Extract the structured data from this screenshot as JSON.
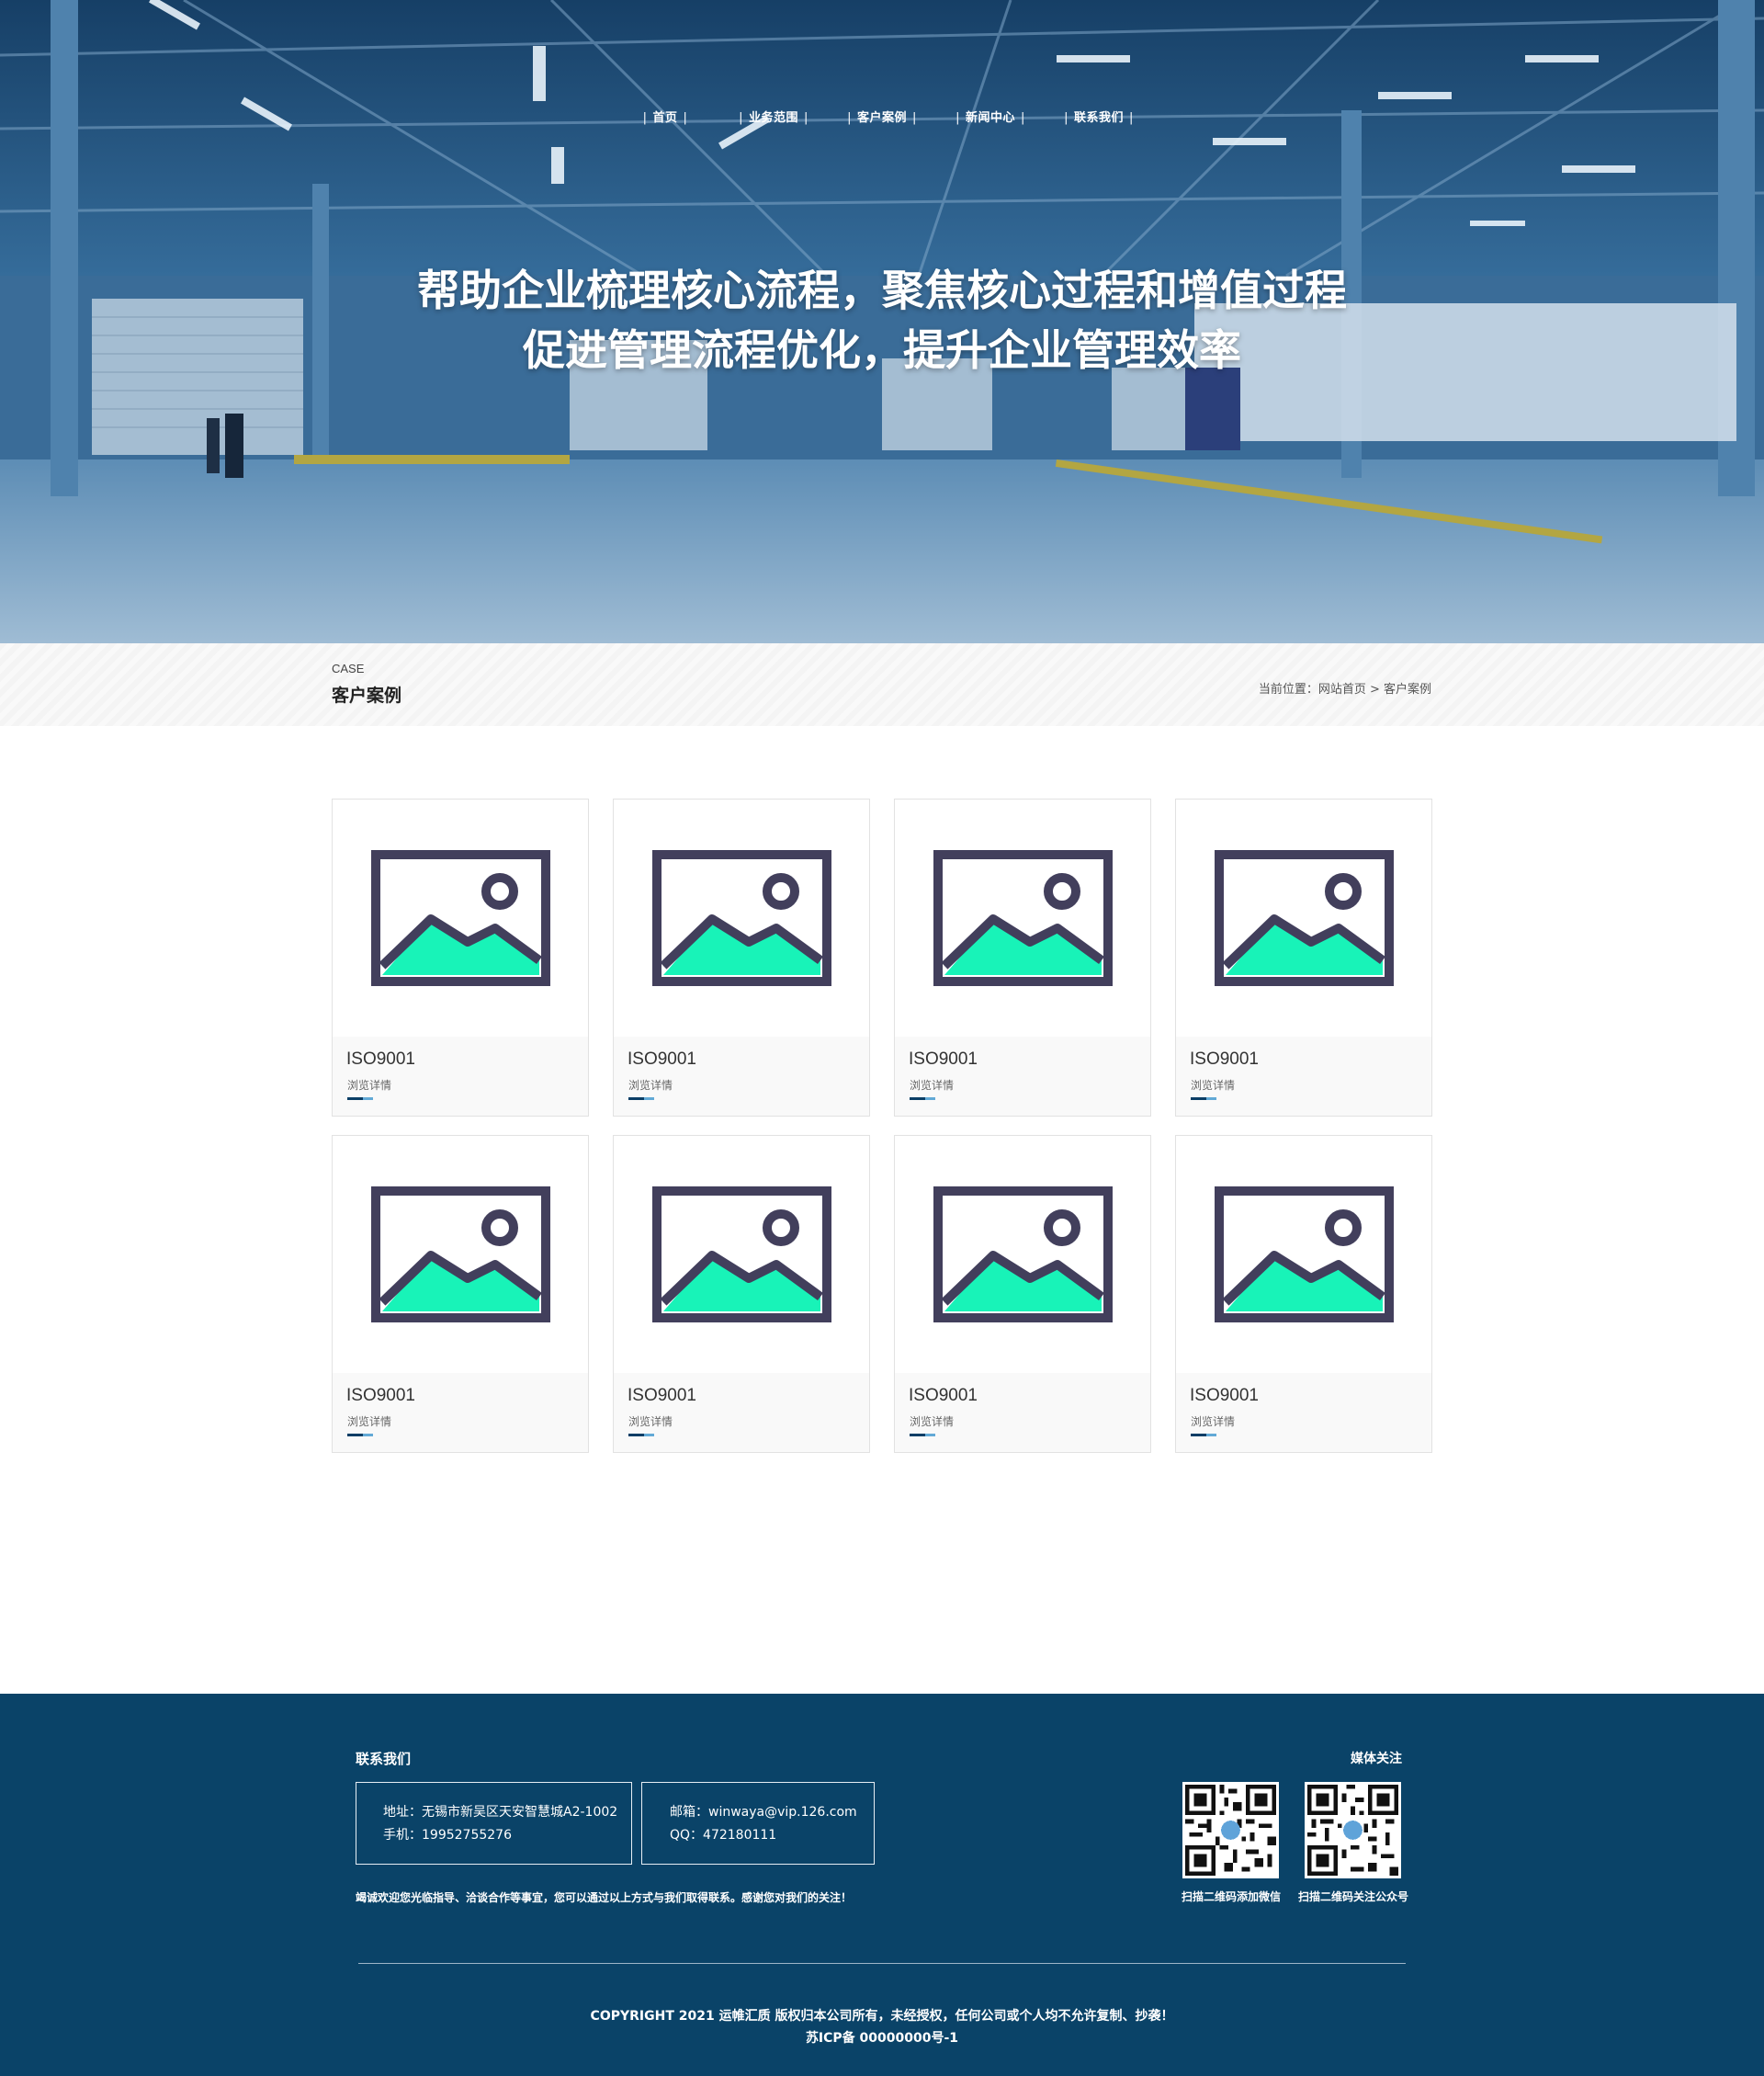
{
  "nav": {
    "items": [
      {
        "label": "首页"
      },
      {
        "label": "业务范围"
      },
      {
        "label": "客户案例"
      },
      {
        "label": "新闻中心"
      },
      {
        "label": "联系我们"
      }
    ]
  },
  "hero": {
    "line1": "帮助企业梳理核心流程，聚焦核心过程和增值过程",
    "line2": "促进管理流程优化，提升企业管理效率"
  },
  "section": {
    "en_title": "CASE",
    "cn_title": "客户案例",
    "breadcrumb": "当前位置：网站首页 > 客户案例"
  },
  "cases": [
    {
      "name": "ISO9001",
      "more": "浏览详情"
    },
    {
      "name": "ISO9001",
      "more": "浏览详情"
    },
    {
      "name": "ISO9001",
      "more": "浏览详情"
    },
    {
      "name": "ISO9001",
      "more": "浏览详情"
    },
    {
      "name": "ISO9001",
      "more": "浏览详情"
    },
    {
      "name": "ISO9001",
      "more": "浏览详情"
    },
    {
      "name": "ISO9001",
      "more": "浏览详情"
    },
    {
      "name": "ISO9001",
      "more": "浏览详情"
    }
  ],
  "footer": {
    "contact_title": "联系我们",
    "address": "地址：无锡市新吴区天安智慧城A2-1002",
    "phone": "手机：19952755276",
    "email": "邮箱：winwaya@vip.126.com",
    "qq": "QQ：472180111",
    "welcome": "竭诚欢迎您光临指导、洽谈合作等事宜，您可以通过以上方式与我们取得联系。感谢您对我们的关注！",
    "media_title": "媒体关注",
    "qr1_caption": "扫描二维码添加微信",
    "qr2_caption": "扫描二维码关注公众号",
    "copyright": "COPYRIGHT   2021  运帷汇质 版权归本公司所有，未经授权，任何公司或个人均不允许复制、抄袭！",
    "icp": "苏ICP备 00000000号-1"
  },
  "colors": {
    "footer_bg": "#0a4368",
    "placeholder_frame": "#423f5c",
    "placeholder_mountain": "#18f3b8",
    "accent_line": "#0a3e66"
  },
  "icons": {
    "card_image": "image-placeholder-icon",
    "qr": "qr-code-icon"
  }
}
